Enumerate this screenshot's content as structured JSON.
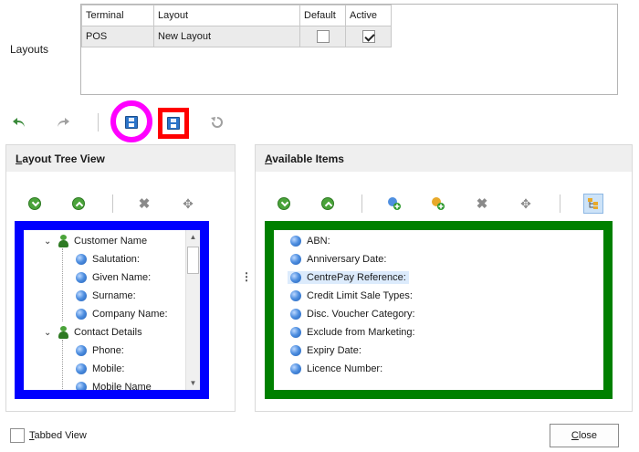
{
  "layouts": {
    "label": "Layouts",
    "columns": [
      "Terminal",
      "Layout",
      "Default",
      "Active"
    ],
    "rows": [
      {
        "terminal": "POS",
        "layout": "New Layout",
        "default": false,
        "active": true
      }
    ]
  },
  "toolbar": {
    "icons": [
      "undo-icon",
      "redo-icon",
      "save-icon",
      "save-as-icon",
      "revert-icon"
    ],
    "highlights": {
      "save": "#ff00ff",
      "save_as": "#ff0000"
    }
  },
  "left_panel": {
    "title_underlined": "L",
    "title_rest": "ayout Tree View",
    "frame_color": "#0000ff",
    "tree": [
      {
        "label": "Customer Name",
        "type": "group"
      },
      {
        "label": "Salutation:",
        "type": "field"
      },
      {
        "label": "Given Name:",
        "type": "field"
      },
      {
        "label": "Surname:",
        "type": "field"
      },
      {
        "label": "Company Name:",
        "type": "field"
      },
      {
        "label": "Contact Details",
        "type": "group"
      },
      {
        "label": "Phone:",
        "type": "field"
      },
      {
        "label": "Mobile:",
        "type": "field"
      },
      {
        "label": "Mobile Name",
        "type": "field"
      }
    ]
  },
  "right_panel": {
    "title_underlined": "A",
    "title_rest": "vailable Items",
    "frame_color": "#008000",
    "items": [
      {
        "label": "ABN:"
      },
      {
        "label": "Anniversary Date:"
      },
      {
        "label": "CentrePay Reference:",
        "selected": true
      },
      {
        "label": "Credit Limit Sale Types:"
      },
      {
        "label": "Disc. Voucher Category:"
      },
      {
        "label": "Exclude from Marketing:"
      },
      {
        "label": "Expiry Date:"
      },
      {
        "label": "Licence Number:"
      }
    ]
  },
  "splitter_label": "⋮",
  "footer": {
    "tabbed_view_underlined": "T",
    "tabbed_view_rest": "abbed View",
    "tabbed_view_checked": false,
    "close_underlined": "C",
    "close_rest": "lose"
  }
}
